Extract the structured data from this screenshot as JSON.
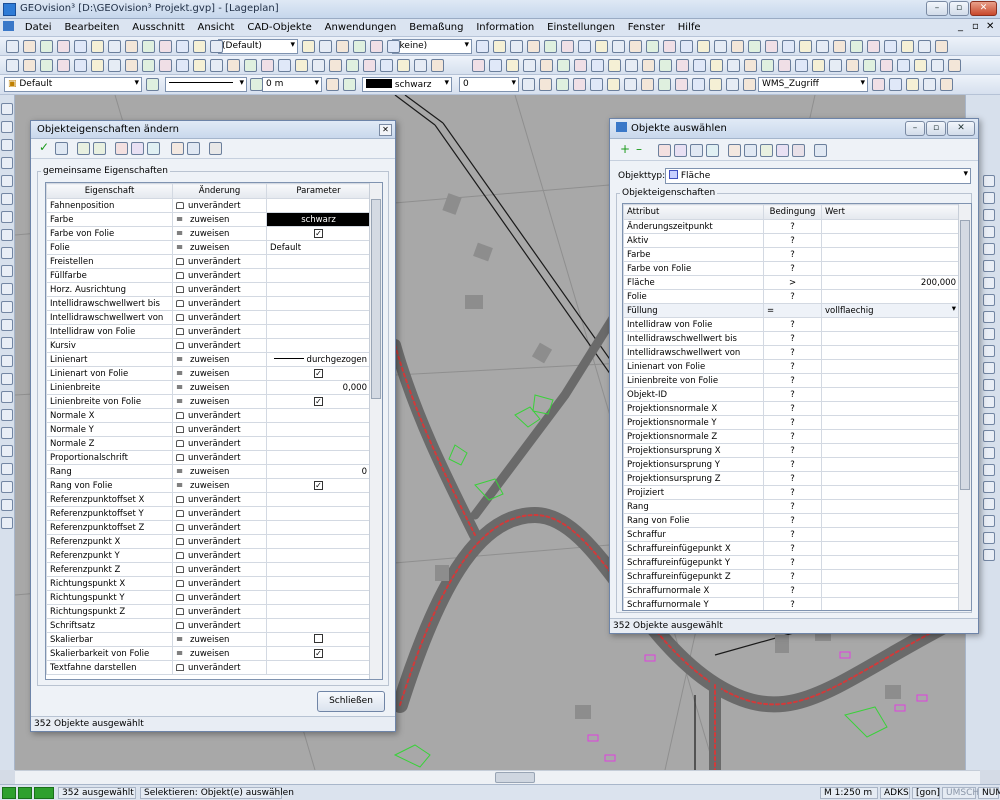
{
  "app": {
    "title": "GEOvision³  [D:\\GEOvision³ Projekt.gvp] - [Lageplan]"
  },
  "menu": [
    "Datei",
    "Bearbeiten",
    "Ausschnitt",
    "Ansicht",
    "CAD-Objekte",
    "Anwendungen",
    "Bemaßung",
    "Information",
    "Einstellungen",
    "Fenster",
    "Hilfe"
  ],
  "toolbar": {
    "combo_default": "(Default)",
    "combo_keine": "(keine)",
    "layer": "Default",
    "linewidth": "0 m",
    "color": "schwarz",
    "rank": "0",
    "wms": "WMS_Zugriff"
  },
  "dialog_left": {
    "title": "Objekteigenschaften ändern",
    "group": "gemeinsame Eigenschaften",
    "headers": [
      "Eigenschaft",
      "Änderung",
      "Parameter"
    ],
    "rows": [
      {
        "p": "Fahnenposition",
        "c": "unverändert",
        "t": "lock",
        "v": ""
      },
      {
        "p": "Farbe",
        "c": "zuweisen",
        "t": "eq",
        "v": "schwarz",
        "k": "black"
      },
      {
        "p": "Farbe von Folie",
        "c": "zuweisen",
        "t": "eq",
        "v": "✓",
        "k": "chk"
      },
      {
        "p": "Folie",
        "c": "zuweisen",
        "t": "eq",
        "v": "Default"
      },
      {
        "p": "Freistellen",
        "c": "unverändert",
        "t": "lock",
        "v": ""
      },
      {
        "p": "Füllfarbe",
        "c": "unverändert",
        "t": "lock",
        "v": ""
      },
      {
        "p": "Horz. Ausrichtung",
        "c": "unverändert",
        "t": "lock",
        "v": ""
      },
      {
        "p": "Intellidrawschwellwert bis",
        "c": "unverändert",
        "t": "lock",
        "v": ""
      },
      {
        "p": "Intellidrawschwellwert von",
        "c": "unverändert",
        "t": "lock",
        "v": ""
      },
      {
        "p": "Intellidraw von Folie",
        "c": "unverändert",
        "t": "lock",
        "v": ""
      },
      {
        "p": "Kursiv",
        "c": "unverändert",
        "t": "lock",
        "v": ""
      },
      {
        "p": "Linienart",
        "c": "zuweisen",
        "t": "eq",
        "v": "durchgezogen",
        "k": "line"
      },
      {
        "p": "Linienart von Folie",
        "c": "zuweisen",
        "t": "eq",
        "v": "✓",
        "k": "chk"
      },
      {
        "p": "Linienbreite",
        "c": "zuweisen",
        "t": "eq",
        "v": "0,000",
        "k": "right"
      },
      {
        "p": "Linienbreite von Folie",
        "c": "zuweisen",
        "t": "eq",
        "v": "✓",
        "k": "chk"
      },
      {
        "p": "Normale X",
        "c": "unverändert",
        "t": "lock",
        "v": ""
      },
      {
        "p": "Normale Y",
        "c": "unverändert",
        "t": "lock",
        "v": ""
      },
      {
        "p": "Normale Z",
        "c": "unverändert",
        "t": "lock",
        "v": ""
      },
      {
        "p": "Proportionalschrift",
        "c": "unverändert",
        "t": "lock",
        "v": ""
      },
      {
        "p": "Rang",
        "c": "zuweisen",
        "t": "eq",
        "v": "0",
        "k": "right"
      },
      {
        "p": "Rang von Folie",
        "c": "zuweisen",
        "t": "eq",
        "v": "✓",
        "k": "chk"
      },
      {
        "p": "Referenzpunktoffset X",
        "c": "unverändert",
        "t": "lock",
        "v": ""
      },
      {
        "p": "Referenzpunktoffset Y",
        "c": "unverändert",
        "t": "lock",
        "v": ""
      },
      {
        "p": "Referenzpunktoffset Z",
        "c": "unverändert",
        "t": "lock",
        "v": ""
      },
      {
        "p": "Referenzpunkt X",
        "c": "unverändert",
        "t": "lock",
        "v": ""
      },
      {
        "p": "Referenzpunkt Y",
        "c": "unverändert",
        "t": "lock",
        "v": ""
      },
      {
        "p": "Referenzpunkt Z",
        "c": "unverändert",
        "t": "lock",
        "v": ""
      },
      {
        "p": "Richtungspunkt X",
        "c": "unverändert",
        "t": "lock",
        "v": ""
      },
      {
        "p": "Richtungspunkt Y",
        "c": "unverändert",
        "t": "lock",
        "v": ""
      },
      {
        "p": "Richtungspunkt Z",
        "c": "unverändert",
        "t": "lock",
        "v": ""
      },
      {
        "p": "Schriftsatz",
        "c": "unverändert",
        "t": "lock",
        "v": ""
      },
      {
        "p": "Skalierbar",
        "c": "zuweisen",
        "t": "eq",
        "v": "",
        "k": "chk"
      },
      {
        "p": "Skalierbarkeit von Folie",
        "c": "zuweisen",
        "t": "eq",
        "v": "✓",
        "k": "chk"
      },
      {
        "p": "Textfahne darstellen",
        "c": "unverändert",
        "t": "lock",
        "v": ""
      }
    ],
    "close_button": "Schließen",
    "status": "352 Objekte ausgewählt"
  },
  "dialog_right": {
    "title": "Objekte auswählen",
    "type_label": "Objekttyp:",
    "type_value": "Fläche",
    "group": "Objekteigenschaften",
    "headers": [
      "Attribut",
      "Bedingung",
      "Wert"
    ],
    "rows": [
      {
        "a": "Änderungszeitpunkt",
        "b": "?",
        "w": ""
      },
      {
        "a": "Aktiv",
        "b": "?",
        "w": ""
      },
      {
        "a": "Farbe",
        "b": "?",
        "w": ""
      },
      {
        "a": "Farbe von Folie",
        "b": "?",
        "w": ""
      },
      {
        "a": "Fläche",
        "b": ">",
        "w": "200,000",
        "k": "right"
      },
      {
        "a": "Folie",
        "b": "?",
        "w": ""
      },
      {
        "a": "Füllung",
        "b": "=",
        "w": "vollflaechig",
        "k": "combo"
      },
      {
        "a": "Intellidraw von Folie",
        "b": "?",
        "w": ""
      },
      {
        "a": "Intellidrawschwellwert bis",
        "b": "?",
        "w": ""
      },
      {
        "a": "Intellidrawschwellwert von",
        "b": "?",
        "w": ""
      },
      {
        "a": "Linienart von Folie",
        "b": "?",
        "w": ""
      },
      {
        "a": "Linienbreite von Folie",
        "b": "?",
        "w": ""
      },
      {
        "a": "Objekt-ID",
        "b": "?",
        "w": ""
      },
      {
        "a": "Projektionsnormale X",
        "b": "?",
        "w": ""
      },
      {
        "a": "Projektionsnormale Y",
        "b": "?",
        "w": ""
      },
      {
        "a": "Projektionsnormale Z",
        "b": "?",
        "w": ""
      },
      {
        "a": "Projektionsursprung X",
        "b": "?",
        "w": ""
      },
      {
        "a": "Projektionsursprung Y",
        "b": "?",
        "w": ""
      },
      {
        "a": "Projektionsursprung Z",
        "b": "?",
        "w": ""
      },
      {
        "a": "Projiziert",
        "b": "?",
        "w": ""
      },
      {
        "a": "Rang",
        "b": "?",
        "w": ""
      },
      {
        "a": "Rang von Folie",
        "b": "?",
        "w": ""
      },
      {
        "a": "Schraffur",
        "b": "?",
        "w": ""
      },
      {
        "a": "Schraffureinfügepunkt X",
        "b": "?",
        "w": ""
      },
      {
        "a": "Schraffureinfügepunkt Y",
        "b": "?",
        "w": ""
      },
      {
        "a": "Schraffureinfügepunkt Z",
        "b": "?",
        "w": ""
      },
      {
        "a": "Schraffurnormale X",
        "b": "?",
        "w": ""
      },
      {
        "a": "Schraffurnormale Y",
        "b": "?",
        "w": ""
      }
    ],
    "status": "352 Objekte ausgewählt"
  },
  "statusbar": {
    "selected": "352 ausgewählt",
    "action": "Selektieren: Objekt(e) auswählen",
    "scale": "M 1:250 m",
    "adks": "ADKS",
    "gon": "[gon]",
    "umsch": "UMSCH",
    "num": "NUM"
  }
}
